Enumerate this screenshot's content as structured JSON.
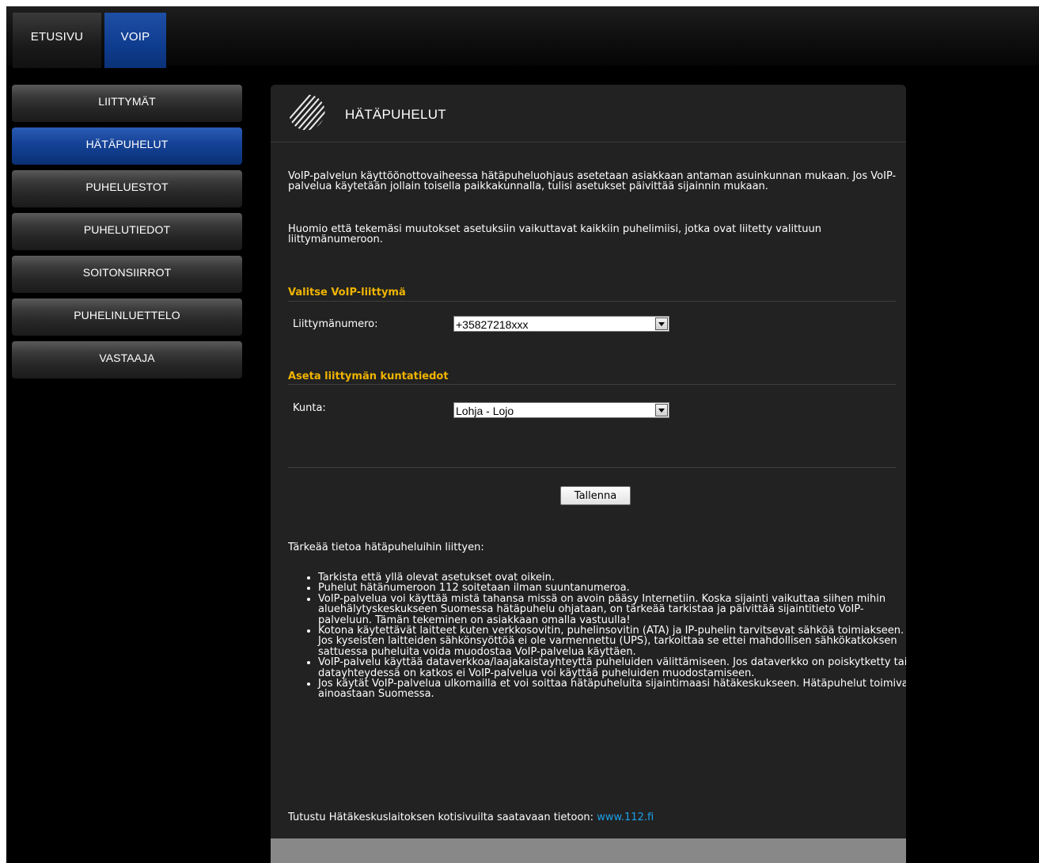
{
  "topnav": {
    "tabs": [
      {
        "label": "ETUSIVU",
        "active": false
      },
      {
        "label": "VOIP",
        "active": true
      }
    ]
  },
  "sidebar": {
    "items": [
      {
        "label": "LIITTYMÄT",
        "active": false
      },
      {
        "label": "HÄTÄPUHELUT",
        "active": true
      },
      {
        "label": "PUHELUESTOT",
        "active": false
      },
      {
        "label": "PUHELUTIEDOT",
        "active": false
      },
      {
        "label": "SOITONSIIRROT",
        "active": false
      },
      {
        "label": "PUHELINLUETTELO",
        "active": false
      },
      {
        "label": "VASTAAJA",
        "active": false
      }
    ]
  },
  "page": {
    "title": "HÄTÄPUHELUT",
    "intro_paragraphs": [
      "VoIP-palvelun käyttöönottovaiheessa hätäpuheluohjaus asetetaan asiakkaan antaman asuinkunnan mukaan. Jos VoIP-palvelua käytetään jollain toisella paikkakunnalla, tulisi asetukset päivittää sijainnin mukaan.",
      "Huomio että tekemäsi muutokset asetuksiin vaikuttavat kaikkiin puhelimiisi, jotka ovat liitetty valittuun liittymänumeroon."
    ],
    "section_select": {
      "title": "Valitse VoIP-liittymä",
      "field_label": "Liittymänumero:",
      "selected_value": "+35827218xxx"
    },
    "section_municipality": {
      "title": "Aseta liittymän kuntatiedot",
      "field_label": "Kunta:",
      "selected_value": "Lohja - Lojo"
    },
    "save_label": "Tallenna",
    "info_heading": "Tärkeää tietoa hätäpuheluihin liittyen:",
    "info_items": [
      "Tarkista että yllä olevat asetukset ovat oikein.",
      "Puhelut hätänumeroon 112 soitetaan ilman suuntanumeroa.",
      "VoIP-palvelua voi käyttää mistä tahansa missä on avoin pääsy Internetiin. Koska sijainti vaikuttaa siihen mihin aluehälytyskeskukseen Suomessa hätäpuhelu ohjataan, on tärkeää tarkistaa ja päivittää sijaintitieto VoIP-palveluun. Tämän tekeminen on asiakkaan omalla vastuulla!",
      "Kotona käytettävät laitteet kuten verkkosovitin, puhelinsovitin (ATA) ja IP-puhelin tarvitsevat sähköä toimiakseen. Jos kyseisten laitteiden sähkönsyöttöä ei ole varmennettu (UPS), tarkoittaa se ettei mahdollisen sähkökatkoksen sattuessa puheluita voida muodostaa VoIP-palvelua käyttäen.",
      "VoIP-palvelu käyttää dataverkkoa/laajakaistayhteyttä puheluiden välittämiseen. Jos dataverkko on poiskytketty tai datayhteydessä on katkos ei VoIP-palvelua voi käyttää puheluiden muodostamiseen.",
      "Jos käytät VoIP-palvelua ulkomailla et voi soittaa hätäpuheluita sijaintimaasi hätäkeskukseen. Hätäpuhelut toimivat ainoastaan Suomessa."
    ],
    "footer_text": "Tutustu Hätäkeskuslaitoksen kotisivuilta saatavaan tietoon:",
    "footer_link": "www.112.fi"
  },
  "colors": {
    "accent_blue": "#0f3c8e",
    "section_title": "#f0b400",
    "link": "#1aa0e8",
    "panel_bg": "#222222"
  }
}
